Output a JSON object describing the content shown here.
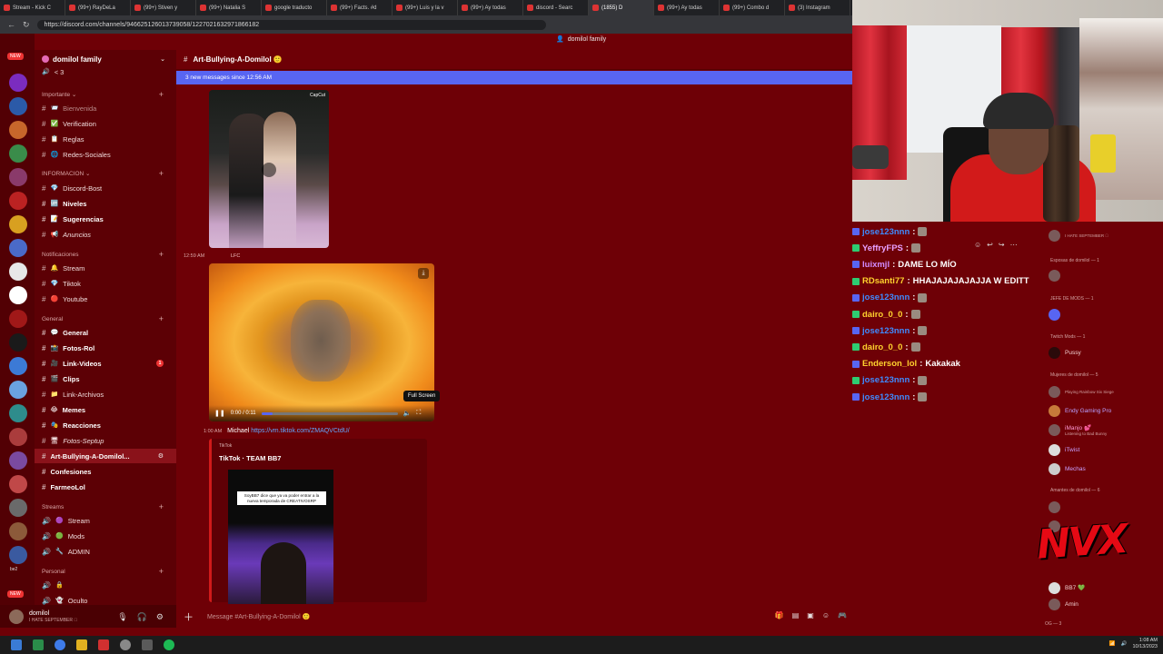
{
  "browser": {
    "tabs": [
      "Stream - Kick C",
      "(99+) RayDeLa",
      "(99+) Stiven y",
      "(99+) Natalia S",
      "google traducto",
      "(99+) Facts. #d",
      "(99+) Luis y la v",
      "(99+) Ay todas",
      "discord - Searc",
      "(1855) D",
      "(99+) Ay todas",
      "(99+) Combo d",
      "(3) Instagram"
    ],
    "url": "https://discord.com/channels/946625126013739058/1227021632971866182"
  },
  "discord": {
    "top_name": "domilol family",
    "server_name": "domilol family",
    "server_sub": "< 3",
    "categories": {
      "importante": "Importante",
      "informacion": "INFORMACION",
      "notificaciones": "Notificaciones",
      "general": "General",
      "streams": "Streams",
      "personal": "Personal"
    },
    "channels": {
      "bienvenida": "Bienvenida",
      "verification": "Verification",
      "reglas": "Reglas",
      "redes": "Redes-Sociales",
      "discord_bost": "Discord-Bost",
      "niveles": "Niveles",
      "sugerencias": "Sugerencias",
      "anuncios": "Anuncios",
      "stream_notif": "Stream",
      "tiktok": "Tiktok",
      "youtube": "Youtube",
      "general": "General",
      "fotos_rol": "Fotos-Rol",
      "link_videos": "Link-Videos",
      "link_videos_count": "1",
      "clips": "Clips",
      "link_archivos": "Link-Archivos",
      "memes": "Memes",
      "reacciones": "Reacciones",
      "fotos_septup": "Fotos-Septup",
      "art_bullying": "Art-Bullying-A-Domilol...",
      "confesiones": "Confesiones",
      "farmeolol": "FarmeoLol",
      "stream_voice": "Stream",
      "mods": "Mods",
      "admin": "ADMIN",
      "oculto": "Oculto"
    },
    "channel_header": "Art-Bullying-A-Domilol 🙂",
    "new_messages_bar": "3 new messages since 12:56 AM",
    "capcut_label": "CapCut",
    "msg1_time": "12:59 AM",
    "msg1_author": "LFC",
    "video_time": "0:00 / 0:11",
    "video_progress": 0.08,
    "fullscreen_tooltip": "Full Screen",
    "link_time": "1:00 AM",
    "link_author": "Michael",
    "link_url": "https://vm.tiktok.com/ZMAQVCtdU/",
    "embed_provider": "TikTok",
    "embed_title": "TikTok · TEAM BB7",
    "embed_caption": "SoyBB7 dice que ya va poder entrar a la nueva temporada de CREATIVOSRP",
    "composer_placeholder": "Message #Art-Bullying-A-Domilol 🙂",
    "user": {
      "name": "domilol",
      "status": "I HATE SEPTEMBER 🏾"
    },
    "server_badges": {
      "top": "NEW",
      "bottom": "NEW",
      "bottom_label": "be2"
    }
  },
  "stream_chat": [
    {
      "user": "jose123nnn",
      "sep": ":",
      "text": "",
      "color": "#3f8bff"
    },
    {
      "user": "YeffryFPS",
      "sep": ":",
      "text": "",
      "color": "#e8a0ff"
    },
    {
      "user": "luixmjl",
      "sep": ":",
      "text": "DAME LO MÍO",
      "color": "#d28cff"
    },
    {
      "user": "RDsanti77",
      "sep": ":",
      "text": "HHAJAJAJAJAJJA W EDITT",
      "color": "#ffd22e"
    },
    {
      "user": "jose123nnn",
      "sep": ":",
      "text": "",
      "color": "#3f8bff"
    },
    {
      "user": "dairo_0_0",
      "sep": ":",
      "text": "",
      "color": "#ffd22e"
    },
    {
      "user": "jose123nnn",
      "sep": ":",
      "text": "",
      "color": "#3f8bff"
    },
    {
      "user": "dairo_0_0",
      "sep": ":",
      "text": "",
      "color": "#ffd22e"
    },
    {
      "user": "Enderson_lol",
      "sep": ":",
      "text": "Kakakak",
      "color": "#ffd22e"
    },
    {
      "user": "jose123nnn",
      "sep": ":",
      "text": "",
      "color": "#3f8bff"
    },
    {
      "user": "jose123nnn",
      "sep": ":",
      "text": "",
      "color": "#3f8bff"
    }
  ],
  "members": {
    "cat_esposas": "Esposas de domilol — 1",
    "cat_jefe": "JEFE DE MODS — 1",
    "cat_twitch": "Twitch Mods — 1",
    "cat_mujeres": "Mujeres de domilol — 5",
    "cat_amantes": "Amantes de domilol — 6",
    "pussy": "Pussy",
    "endy": "Endy Gaming Pro",
    "imanjo": "iManjo 💕",
    "imanjo_act": "Listening to Bad Bunny",
    "jigsaw_act": "Playing Rainbow Six Siege",
    "itwist": "iTwist",
    "mechas": "Mechas",
    "bb7": "BB7 💚",
    "amin": "Amin",
    "og": "OG — 3",
    "watermark": "NVX",
    "top_status": "I HATE SEPTEMBER 🏾"
  },
  "taskbar": {
    "time": "1:08 AM",
    "date": "10/13/2023"
  }
}
